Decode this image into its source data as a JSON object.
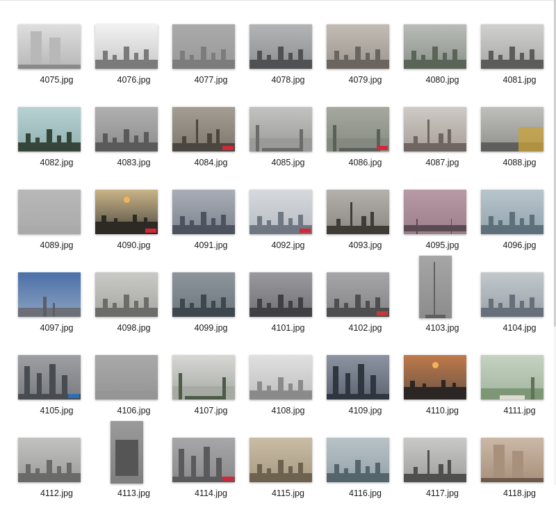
{
  "window": {
    "view": "large-icons"
  },
  "files": [
    {
      "name": "4075.jpg",
      "variant": "wide",
      "palette": [
        "#dedede",
        "#b8b8b8",
        "#8a8a8a"
      ],
      "scene": "cctv-person"
    },
    {
      "name": "4076.jpg",
      "variant": "wide",
      "palette": [
        "#f2f2f2",
        "#c8c8c8",
        "#7a7a7a"
      ],
      "scene": "skyline-low"
    },
    {
      "name": "4077.jpg",
      "variant": "wide",
      "palette": [
        "#aaaaaa",
        "#999999",
        "#7c7c7c"
      ],
      "scene": "haze-towers"
    },
    {
      "name": "4078.jpg",
      "variant": "wide",
      "palette": [
        "#b2b4b6",
        "#8d8f91",
        "#4f5153"
      ],
      "scene": "street-lights"
    },
    {
      "name": "4079.jpg",
      "variant": "wide",
      "palette": [
        "#c2bcb4",
        "#9c9690",
        "#6a655f"
      ],
      "scene": "street-trees"
    },
    {
      "name": "4080.jpg",
      "variant": "wide",
      "palette": [
        "#b9bcb7",
        "#8b928b",
        "#5a6558"
      ],
      "scene": "river-aerial"
    },
    {
      "name": "4081.jpg",
      "variant": "wide",
      "palette": [
        "#d0d0ce",
        "#a8a8a6",
        "#5c5c5a"
      ],
      "scene": "bridge-cyclist"
    },
    {
      "name": "4082.jpg",
      "variant": "wide",
      "palette": [
        "#b8d2d2",
        "#8fb0b0",
        "#35453a"
      ],
      "scene": "palace"
    },
    {
      "name": "4083.jpg",
      "variant": "wide",
      "palette": [
        "#b0b0b0",
        "#8c8c8c",
        "#5a5a5a"
      ],
      "scene": "tower-block"
    },
    {
      "name": "4084.jpg",
      "variant": "wide",
      "palette": [
        "#a39d93",
        "#7d776d",
        "#4b463f"
      ],
      "scene": "pearl-tower",
      "tag": "#d3273a"
    },
    {
      "name": "4085.jpg",
      "variant": "wide",
      "palette": [
        "#c2c2c0",
        "#9a9a98",
        "#6b6b69"
      ],
      "scene": "road-aerial"
    },
    {
      "name": "4086.jpg",
      "variant": "wide",
      "palette": [
        "#a6a8a0",
        "#858a80",
        "#58605a"
      ],
      "scene": "highway",
      "tag": "#d3273a"
    },
    {
      "name": "4087.jpg",
      "variant": "wide",
      "palette": [
        "#cfcac6",
        "#a79f9a",
        "#6f6561"
      ],
      "scene": "tv-tower-street"
    },
    {
      "name": "4088.jpg",
      "variant": "wide",
      "palette": [
        "#bfbfbc",
        "#8f8f8c",
        "#5f5f5c"
      ],
      "scene": "crane-yellow"
    },
    {
      "name": "4089.jpg",
      "variant": "wide",
      "palette": [
        "#b8b8b8",
        "#aaaaaa",
        "#999999"
      ],
      "scene": "flat-haze"
    },
    {
      "name": "4090.jpg",
      "variant": "wide",
      "palette": [
        "#c9b486",
        "#4f4b43",
        "#2d2a25"
      ],
      "scene": "sunset-city",
      "tag": "#d3273a"
    },
    {
      "name": "4091.jpg",
      "variant": "wide",
      "palette": [
        "#a9adb6",
        "#7d838f",
        "#4c525e"
      ],
      "scene": "dome-towers"
    },
    {
      "name": "4092.jpg",
      "variant": "wide",
      "palette": [
        "#d6d9dd",
        "#b6bcc2",
        "#6f7882"
      ],
      "scene": "lakeside-tree",
      "tag": "#d3273a"
    },
    {
      "name": "4093.jpg",
      "variant": "wide",
      "palette": [
        "#b5b2ae",
        "#8a8682",
        "#3f3c38"
      ],
      "scene": "walker-kite"
    },
    {
      "name": "4095.jpg",
      "variant": "wide",
      "palette": [
        "#b79aa6",
        "#9a7e8a",
        "#5c4a52"
      ],
      "scene": "pink-bridge"
    },
    {
      "name": "4096.jpg",
      "variant": "wide",
      "palette": [
        "#b8c5cc",
        "#93a4ad",
        "#5e707b"
      ],
      "scene": "blue-skyline"
    },
    {
      "name": "4097.jpg",
      "variant": "wide",
      "palette": [
        "#4a6fa8",
        "#8aa2c0",
        "#d9c6b8"
      ],
      "scene": "blue-sky-city"
    },
    {
      "name": "4098.jpg",
      "variant": "wide",
      "palette": [
        "#c9c9c6",
        "#a6a6a3",
        "#6c6c69"
      ],
      "scene": "street-tree-bare"
    },
    {
      "name": "4099.jpg",
      "variant": "wide",
      "palette": [
        "#8e969c",
        "#6d767e",
        "#3f474e"
      ],
      "scene": "dark-city"
    },
    {
      "name": "4101.jpg",
      "variant": "wide",
      "palette": [
        "#9a9a9e",
        "#727276",
        "#3f3f44"
      ],
      "scene": "spires"
    },
    {
      "name": "4102.jpg",
      "variant": "wide",
      "palette": [
        "#a6a6a8",
        "#858587",
        "#4e4e50"
      ],
      "scene": "office-red",
      "tag": "#c83a3a"
    },
    {
      "name": "4103.jpg",
      "variant": "tall",
      "palette": [
        "#a6a6a6",
        "#8c8c8c",
        "#5f5f5f"
      ],
      "scene": "lamppost"
    },
    {
      "name": "4104.jpg",
      "variant": "wide",
      "palette": [
        "#c2c8cc",
        "#9aa3aa",
        "#67707a"
      ],
      "scene": "street-signs"
    },
    {
      "name": "4105.jpg",
      "variant": "wide",
      "palette": [
        "#9d9fa3",
        "#797c81",
        "#484b50"
      ],
      "scene": "twin-towers",
      "tag": "#2c6fb6"
    },
    {
      "name": "4106.jpg",
      "variant": "wide",
      "palette": [
        "#a9a9a9",
        "#959595",
        "#7a7a7a"
      ],
      "scene": "grey-field"
    },
    {
      "name": "4107.jpg",
      "variant": "wide",
      "palette": [
        "#d7d7d3",
        "#a6aaa3",
        "#4c5a46"
      ],
      "scene": "traffic"
    },
    {
      "name": "4108.jpg",
      "variant": "wide",
      "palette": [
        "#e0e0e0",
        "#bfbfbf",
        "#8a8a8a"
      ],
      "scene": "bridge-fog"
    },
    {
      "name": "4109.jpg",
      "variant": "wide",
      "palette": [
        "#8b94a0",
        "#5d6672",
        "#2f3640"
      ],
      "scene": "night-towers"
    },
    {
      "name": "4110.jpg",
      "variant": "wide",
      "palette": [
        "#c07a4a",
        "#6b5446",
        "#2b2624"
      ],
      "scene": "orange-sun"
    },
    {
      "name": "4111.jpg",
      "variant": "wide",
      "palette": [
        "#c5d3c2",
        "#a1b39c",
        "#5f7158"
      ],
      "scene": "green-interchange"
    },
    {
      "name": "4112.jpg",
      "variant": "wide",
      "palette": [
        "#c2c2c0",
        "#9c9c9a",
        "#6a6a68"
      ],
      "scene": "cranes-grey"
    },
    {
      "name": "4113.jpg",
      "variant": "tall",
      "palette": [
        "#9a9a9a",
        "#808080",
        "#555555"
      ],
      "scene": "tall-building"
    },
    {
      "name": "4114.jpg",
      "variant": "wide",
      "palette": [
        "#a7a7a9",
        "#8a8a8c",
        "#5a5a5c"
      ],
      "scene": "grey-towers",
      "tag": "#d3273a"
    },
    {
      "name": "4115.jpg",
      "variant": "wide",
      "palette": [
        "#c9bca5",
        "#a89a81",
        "#6d624f"
      ],
      "scene": "sepia-city"
    },
    {
      "name": "4116.jpg",
      "variant": "wide",
      "palette": [
        "#b8c3c7",
        "#93a2a8",
        "#55656c"
      ],
      "scene": "teal-haze"
    },
    {
      "name": "4117.jpg",
      "variant": "wide",
      "palette": [
        "#c9c9c7",
        "#9f9f9d",
        "#4f4f4d"
      ],
      "scene": "tv-tower-dark"
    },
    {
      "name": "4118.jpg",
      "variant": "wide",
      "palette": [
        "#cbb8a6",
        "#a8917c",
        "#6c5a4a"
      ],
      "scene": "cctv-brown"
    }
  ]
}
